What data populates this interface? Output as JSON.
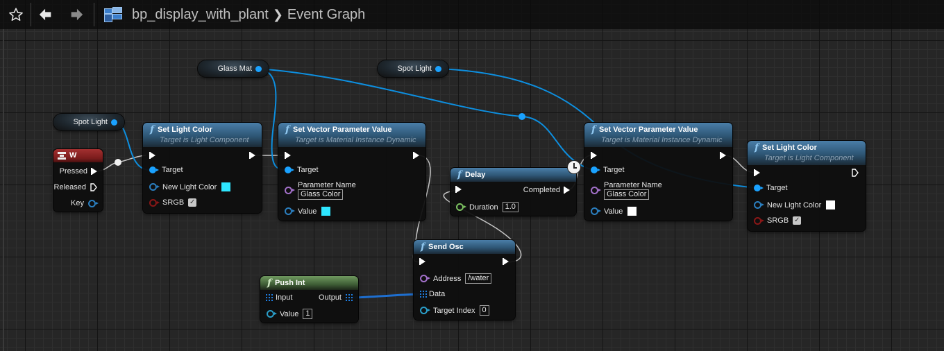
{
  "toolbar": {
    "favorite_icon": "star-icon",
    "back_icon": "arrow-left-icon",
    "forward_icon": "arrow-right-icon",
    "blueprint_icon": "blueprint-icon",
    "breadcrumb": [
      "bp_display_with_plant",
      "Event Graph"
    ],
    "separator_glyph": "❯"
  },
  "colors": {
    "object_pin": "#1aa2ff",
    "exec_pin": "#ffffff",
    "function_header": "#3b6c92",
    "pure_function_header": "#5e8a4f",
    "event_header": "#8f2424",
    "cyan_value": "#2ee6ff",
    "white_value": "#ffffff"
  },
  "variables": [
    {
      "id": "glass-mat",
      "label": "Glass Mat"
    },
    {
      "id": "spot-light-top",
      "label": "Spot Light"
    },
    {
      "id": "spot-light-left",
      "label": "Spot Light"
    }
  ],
  "nodes": {
    "key_w": {
      "title": "W",
      "pins": {
        "pressed": "Pressed",
        "released": "Released",
        "key": "Key"
      }
    },
    "set_light_color_1": {
      "title": "Set Light Color",
      "subtitle": "Target is Light Component",
      "pins": {
        "target": "Target",
        "new_light_color": "New Light Color",
        "srgb": "SRGB"
      },
      "new_light_color_value": "#2ee6ff",
      "srgb_checked": true
    },
    "set_vector_param_1": {
      "title": "Set Vector Parameter Value",
      "subtitle": "Target is Material Instance Dynamic",
      "pins": {
        "target": "Target",
        "parameter_name": "Parameter Name",
        "value": "Value"
      },
      "parameter_name_value": "Glass Color",
      "value_color": "#2ee6ff"
    },
    "delay": {
      "title": "Delay",
      "pins": {
        "completed": "Completed",
        "duration": "Duration"
      },
      "duration_value": "1.0"
    },
    "set_vector_param_2": {
      "title": "Set Vector Parameter Value",
      "subtitle": "Target is Material Instance Dynamic",
      "pins": {
        "target": "Target",
        "parameter_name": "Parameter Name",
        "value": "Value"
      },
      "parameter_name_value": "Glass Color",
      "value_color": "#ffffff"
    },
    "set_light_color_2": {
      "title": "Set Light Color",
      "subtitle": "Target is Light Component",
      "pins": {
        "target": "Target",
        "new_light_color": "New Light Color",
        "srgb": "SRGB"
      },
      "new_light_color_value": "#ffffff",
      "srgb_checked": true
    },
    "send_osc": {
      "title": "Send Osc",
      "pins": {
        "address": "Address",
        "data": "Data",
        "target_index": "Target Index"
      },
      "address_value": "/water",
      "target_index_value": "0"
    },
    "push_int": {
      "title": "Push Int",
      "pins": {
        "input": "Input",
        "output": "Output",
        "value": "Value"
      },
      "value_value": "1"
    }
  }
}
